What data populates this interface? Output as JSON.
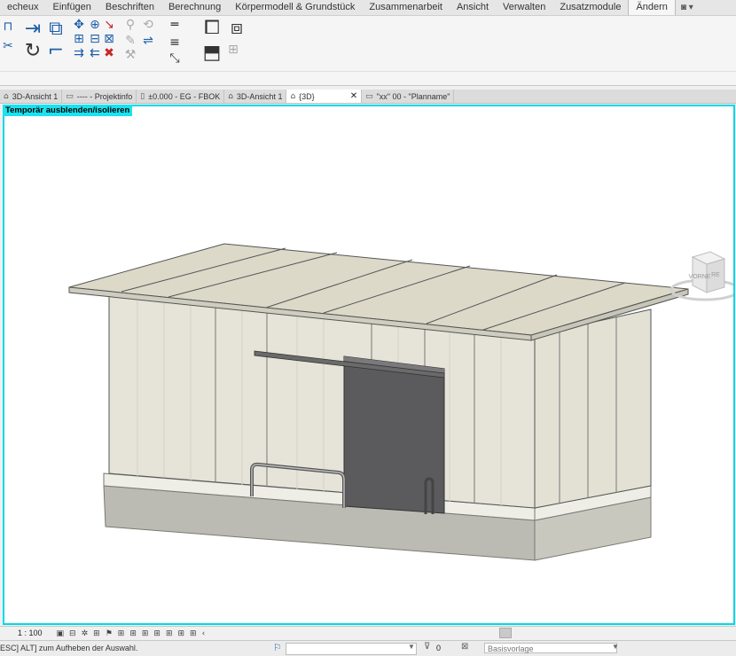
{
  "menubar": {
    "tabs": [
      "echeux",
      "Einfügen",
      "Beschriften",
      "Berechnung",
      "Körpermodell & Grundstück",
      "Zusammenarbeit",
      "Ansicht",
      "Verwalten",
      "Zusatzmodule",
      "Ändern"
    ],
    "active_index": 9,
    "extra": "◙ ▾"
  },
  "view_tabs": [
    {
      "icon": "3d-view-icon",
      "glyph": "⌂",
      "label": "3D-Ansicht 1"
    },
    {
      "icon": "sheet-icon",
      "glyph": "▭",
      "label": "---- - Projektinfo"
    },
    {
      "icon": "plan-icon",
      "glyph": "▯",
      "label": "±0.000 - EG - FBOK"
    },
    {
      "icon": "3d-view-icon",
      "glyph": "⌂",
      "label": "3D-Ansicht 1"
    },
    {
      "icon": "3d-view-icon",
      "glyph": "⌂",
      "label": "{3D}",
      "active": true,
      "close": "✕"
    },
    {
      "icon": "sheet-icon",
      "glyph": "▭",
      "label": "\"xx\" 00 - \"Planname\""
    }
  ],
  "viewport": {
    "isolate_label": "Temporär ausblenden/isolieren",
    "border_color": "#00d8e8",
    "label_color": "#19e3f0"
  },
  "viewcube": {
    "front_label": "VORNE",
    "right_label": "RE"
  },
  "view_control_bar": {
    "scale": "1 : 100",
    "icons": [
      "▣",
      "⊟",
      "✲",
      "⊞",
      "⚑",
      "⊞",
      "⊞",
      "⊞",
      "⊞",
      "⊞",
      "⊞",
      "⊞",
      "‹"
    ]
  },
  "status_bar": {
    "message": "ESC] ALT] zum Aufheben der Auswahl.",
    "selection_count": "0",
    "design_option": "Basisvorlage"
  },
  "colors": {
    "roof_top": "#dcd9c9",
    "wall": "#e4e2d6",
    "wall_side": "#d9d7ca",
    "door": "#58585a",
    "concrete": "#b9b8b0",
    "accent": "#00d8e8"
  }
}
